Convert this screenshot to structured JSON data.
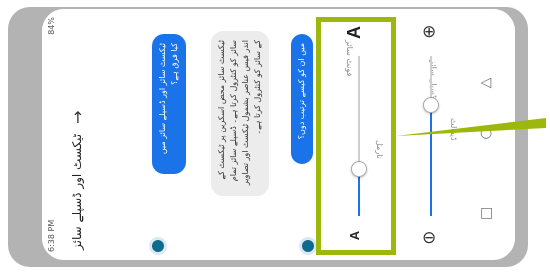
{
  "status": {
    "time": "6:38 PM",
    "battery": "84%"
  },
  "header": {
    "title": "ٹیکسٹ اور ڈسپلے سائز"
  },
  "chat": {
    "q1": "ٹیکسٹ سائز اور ڈسپلے سائز میں کیا فرق ہے؟",
    "a1": "ٹیکسٹ سائز محض اسکرین پر ٹیکسٹ کے سائز کو کنٹرول کرتا ہے۔ ڈسپلے سائز تمام اندر فیس عناصر بشمول ٹیکسٹ اور تصاویر کے سائز کو کنٹرول کرتا ہے۔",
    "q2": "میں ان کو کیسے ترتیب دوں؟"
  },
  "font_size": {
    "label": "فونٹ سائز",
    "value_label": "نارمل",
    "small_a": "A",
    "large_a": "A",
    "level": 0.3
  },
  "display_size": {
    "label": "ڈسپلے سائز",
    "value_label": "ڈیفالٹ",
    "minus": "⊖",
    "plus": "⊕",
    "level": 0.7
  },
  "colors": {
    "accent": "#1a73e8",
    "highlight": "#9eb70c",
    "frame": "#b3b3b3"
  },
  "icons": {
    "back": "arrow-back-icon",
    "nav_back": "triangle-back-icon",
    "nav_home": "circle-home-icon",
    "nav_recent": "square-recents-icon"
  }
}
